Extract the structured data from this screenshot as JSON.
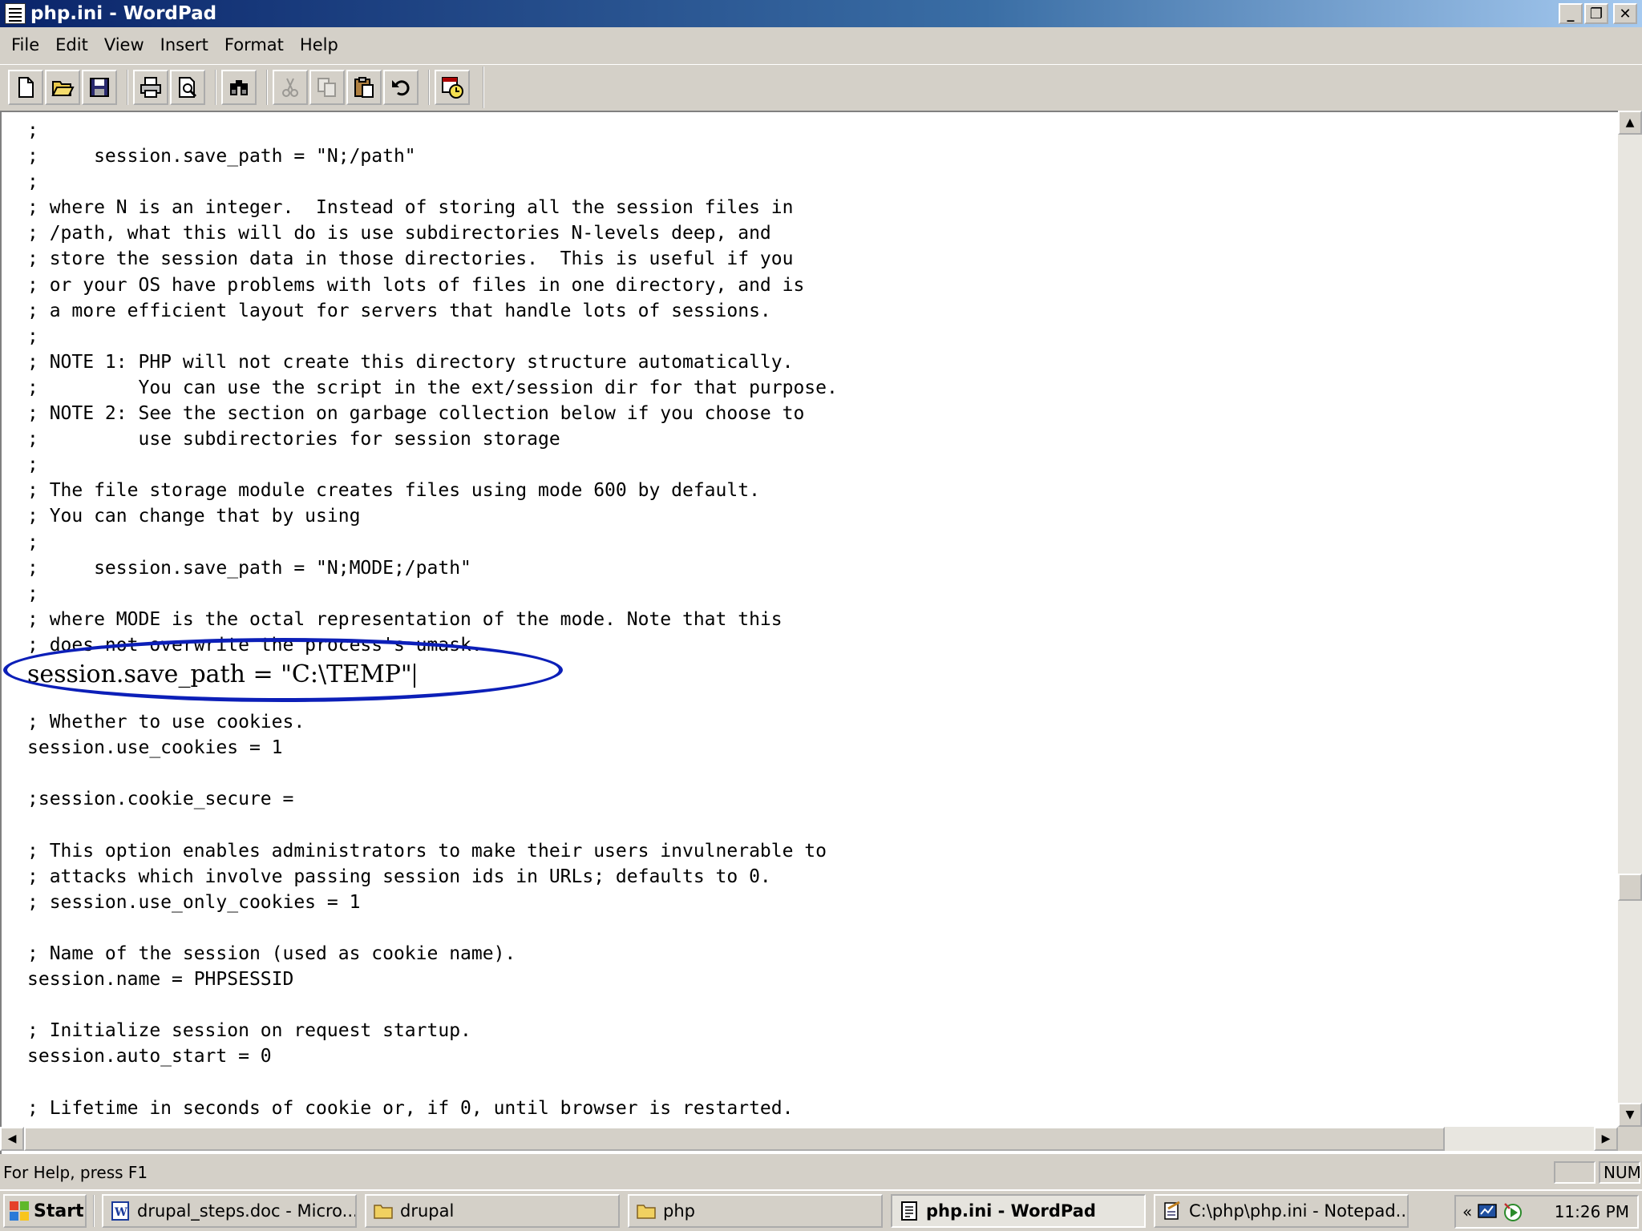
{
  "window": {
    "title": "php.ini - WordPad"
  },
  "menu": {
    "items": [
      "File",
      "Edit",
      "View",
      "Insert",
      "Format",
      "Help"
    ]
  },
  "toolbar": {
    "buttons": [
      "new",
      "open",
      "save",
      "print",
      "print-preview",
      "find",
      "cut",
      "copy",
      "paste",
      "undo",
      "date-time"
    ]
  },
  "document": {
    "lines": [
      ";",
      ";     session.save_path = \"N;/path\"",
      ";",
      "; where N is an integer.  Instead of storing all the session files in",
      "; /path, what this will do is use subdirectories N-levels deep, and",
      "; store the session data in those directories.  This is useful if you",
      "; or your OS have problems with lots of files in one directory, and is",
      "; a more efficient layout for servers that handle lots of sessions.",
      ";",
      "; NOTE 1: PHP will not create this directory structure automatically.",
      ";         You can use the script in the ext/session dir for that purpose.",
      "; NOTE 2: See the section on garbage collection below if you choose to",
      ";         use subdirectories for session storage",
      ";",
      "; The file storage module creates files using mode 600 by default.",
      "; You can change that by using",
      ";",
      ";     session.save_path = \"N;MODE;/path\"",
      ";",
      "; where MODE is the octal representation of the mode. Note that this",
      "; does not overwrite the process's umask.",
      "session.save_path = \"C:\\TEMP\"",
      "",
      "; Whether to use cookies.",
      "session.use_cookies = 1",
      "",
      ";session.cookie_secure =",
      "",
      "; This option enables administrators to make their users invulnerable to",
      "; attacks which involve passing session ids in URLs; defaults to 0.",
      "; session.use_only_cookies = 1",
      "",
      "; Name of the session (used as cookie name).",
      "session.name = PHPSESSID",
      "",
      "; Initialize session on request startup.",
      "session.auto_start = 0",
      "",
      "; Lifetime in seconds of cookie or, if 0, until browser is restarted."
    ],
    "highlighted_line_index": 21,
    "highlight_color": "#0c1fb8"
  },
  "statusbar": {
    "help": "For Help, press F1",
    "num": "NUM"
  },
  "taskbar": {
    "start": "Start",
    "tasks": [
      {
        "label": "drupal_steps.doc - Micro...",
        "icon": "word-doc-icon"
      },
      {
        "label": "drupal",
        "icon": "folder-icon"
      },
      {
        "label": "php",
        "icon": "folder-icon"
      },
      {
        "label": "php.ini - WordPad",
        "icon": "wordpad-icon",
        "active": true
      },
      {
        "label": "C:\\php\\php.ini - Notepad...",
        "icon": "notepad-icon"
      }
    ],
    "tray": {
      "expand": "«",
      "clock": "11:26 PM"
    }
  }
}
